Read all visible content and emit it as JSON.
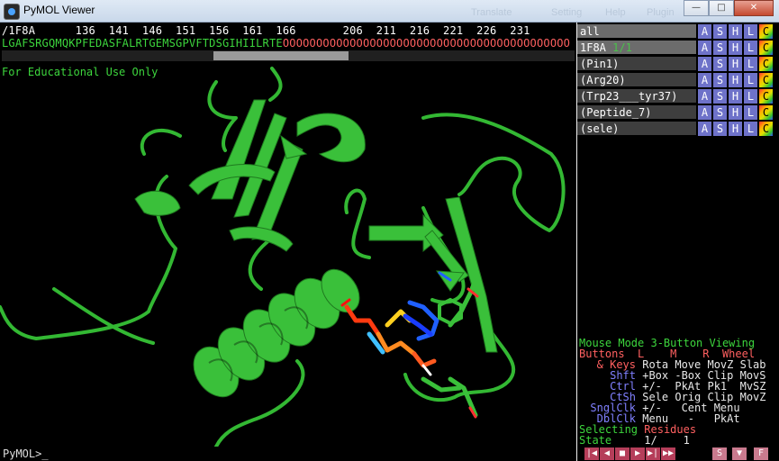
{
  "window": {
    "title": "PyMOL Viewer",
    "background_menu_ghost": [
      "Translate",
      "Setting",
      "Help",
      "Plugin"
    ]
  },
  "sequence": {
    "numbers_line": "/1F8A      136  141  146  151  156  161  166       206  211  216  221  226  231",
    "residues": "LGAFSRGQMQKPFEDASFALRTGEMSGPVFTDSGIHIILRTE",
    "unresolved": "OOOOOOOOOOOOOOOOOOOOOOOOOOOOOOOOOOOOOOOOOOO",
    "colors": {
      "residues": "#3dd63d",
      "unresolved": "#ff4a4a",
      "numbers": "#ffffff"
    }
  },
  "viewport": {
    "watermark": "For Educational Use Only",
    "background": "#000000",
    "cartoon_color": "#39c239"
  },
  "objects": [
    {
      "name": "all",
      "state": ""
    },
    {
      "name": "1F8A",
      "state": "1/1"
    },
    {
      "name": "(Pin1)",
      "state": ""
    },
    {
      "name": "(Arg20)",
      "state": ""
    },
    {
      "name": "(Trp23___tyr37)",
      "state": ""
    },
    {
      "name": "(Peptide_7)",
      "state": ""
    },
    {
      "name": "(sele)",
      "state": ""
    }
  ],
  "object_buttons": [
    "A",
    "S",
    "H",
    "L",
    "C"
  ],
  "mouse": {
    "mode_line": "Mouse Mode 3-Button Viewing",
    "header_line": "Buttons  L    M    R  Wheel",
    "keys_label": "& Keys",
    "keys_values": "Rota Move MovZ Slab",
    "shft_label": "Shft",
    "shft_values": "+Box -Box Clip MovS",
    "ctrl_label": "Ctrl",
    "ctrl_values": "+/-  PkAt Pk1  MvSZ",
    "ctsh_label": "CtSh",
    "ctsh_values": "Sele Orig Clip MovZ",
    "sngl_label": "SnglClk",
    "sngl_values": "+/-   Cent Menu",
    "dbl_label": "DblClk",
    "dbl_values": "Menu   -   PkAt",
    "selecting_label": "Selecting",
    "selecting_value": "Residues",
    "state_label": "State",
    "state_value": "1/    1"
  },
  "command_prompt": "PyMOL>_",
  "playback_buttons": [
    "|◀",
    "◀",
    "■",
    "▶",
    "▶|",
    "▶▶",
    "S",
    "▼",
    "F"
  ]
}
